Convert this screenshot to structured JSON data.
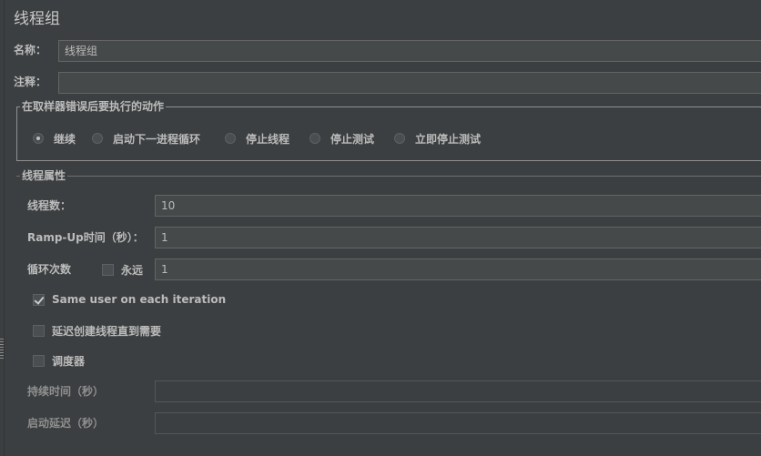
{
  "page": {
    "title": "线程组"
  },
  "name_field": {
    "label": "名称：",
    "value": "线程组"
  },
  "comment_field": {
    "label": "注释：",
    "value": ""
  },
  "error_action": {
    "legend": "在取样器错误后要执行的动作",
    "options": [
      {
        "label": "继续",
        "checked": true
      },
      {
        "label": "启动下一进程循环",
        "checked": false
      },
      {
        "label": "停止线程",
        "checked": false
      },
      {
        "label": "停止测试",
        "checked": false
      },
      {
        "label": "立即停止测试",
        "checked": false
      }
    ]
  },
  "thread_props": {
    "legend": "线程属性",
    "num_threads": {
      "label": "线程数：",
      "value": "10"
    },
    "ramp_up": {
      "label": "Ramp-Up时间（秒）：",
      "value": "1"
    },
    "loop": {
      "label": "循环次数",
      "forever_label": "永远",
      "forever_checked": false,
      "value": "1"
    },
    "same_user": {
      "label": "Same user on each iteration",
      "checked": true
    },
    "delay_create": {
      "label": "延迟创建线程直到需要",
      "checked": false
    },
    "scheduler": {
      "label": "调度器",
      "checked": false
    },
    "duration": {
      "label": "持续时间（秒）",
      "value": ""
    },
    "startup_delay": {
      "label": "启动延迟（秒）",
      "value": ""
    }
  }
}
